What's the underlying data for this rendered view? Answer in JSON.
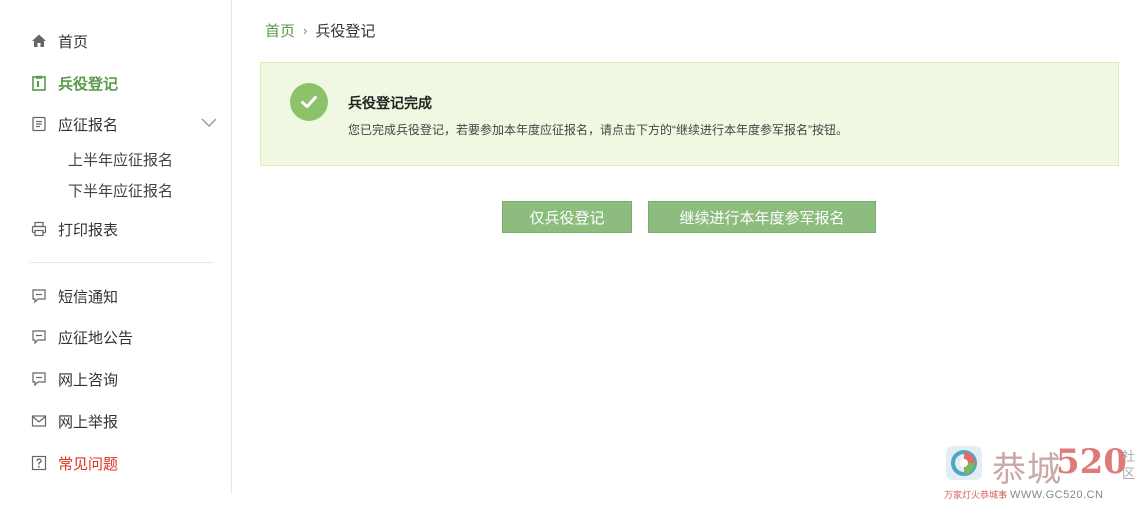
{
  "sidebar": {
    "items": [
      {
        "label": "首页"
      },
      {
        "label": "兵役登记"
      },
      {
        "label": "应征报名"
      },
      {
        "label": "打印报表"
      },
      {
        "label": "短信通知"
      },
      {
        "label": "应征地公告"
      },
      {
        "label": "网上咨询"
      },
      {
        "label": "网上举报"
      },
      {
        "label": "常见问题"
      }
    ],
    "sub_items": [
      {
        "label": "上半年应征报名"
      },
      {
        "label": "下半年应征报名"
      }
    ],
    "active_color": "#5a9a4a",
    "highlight_color": "#e0301e"
  },
  "breadcrumb": {
    "home": "首页",
    "separator": "›",
    "current": "兵役登记"
  },
  "panel": {
    "title": "兵役登记完成",
    "message": "您已完成兵役登记，若要参加本年度应征报名，请点击下方的“继续进行本年度参军报名”按钮。",
    "bg_color": "#f0f8e2"
  },
  "buttons": {
    "register_only": "仅兵役登记",
    "continue_enlist": "继续进行本年度参军报名",
    "color": "#8cbd7e"
  },
  "watermark": {
    "main": "恭城",
    "number": "520",
    "side": "社区",
    "bottom_cn": "万家灯火恭城事",
    "bottom_url": "WWW.GC520.CN"
  }
}
